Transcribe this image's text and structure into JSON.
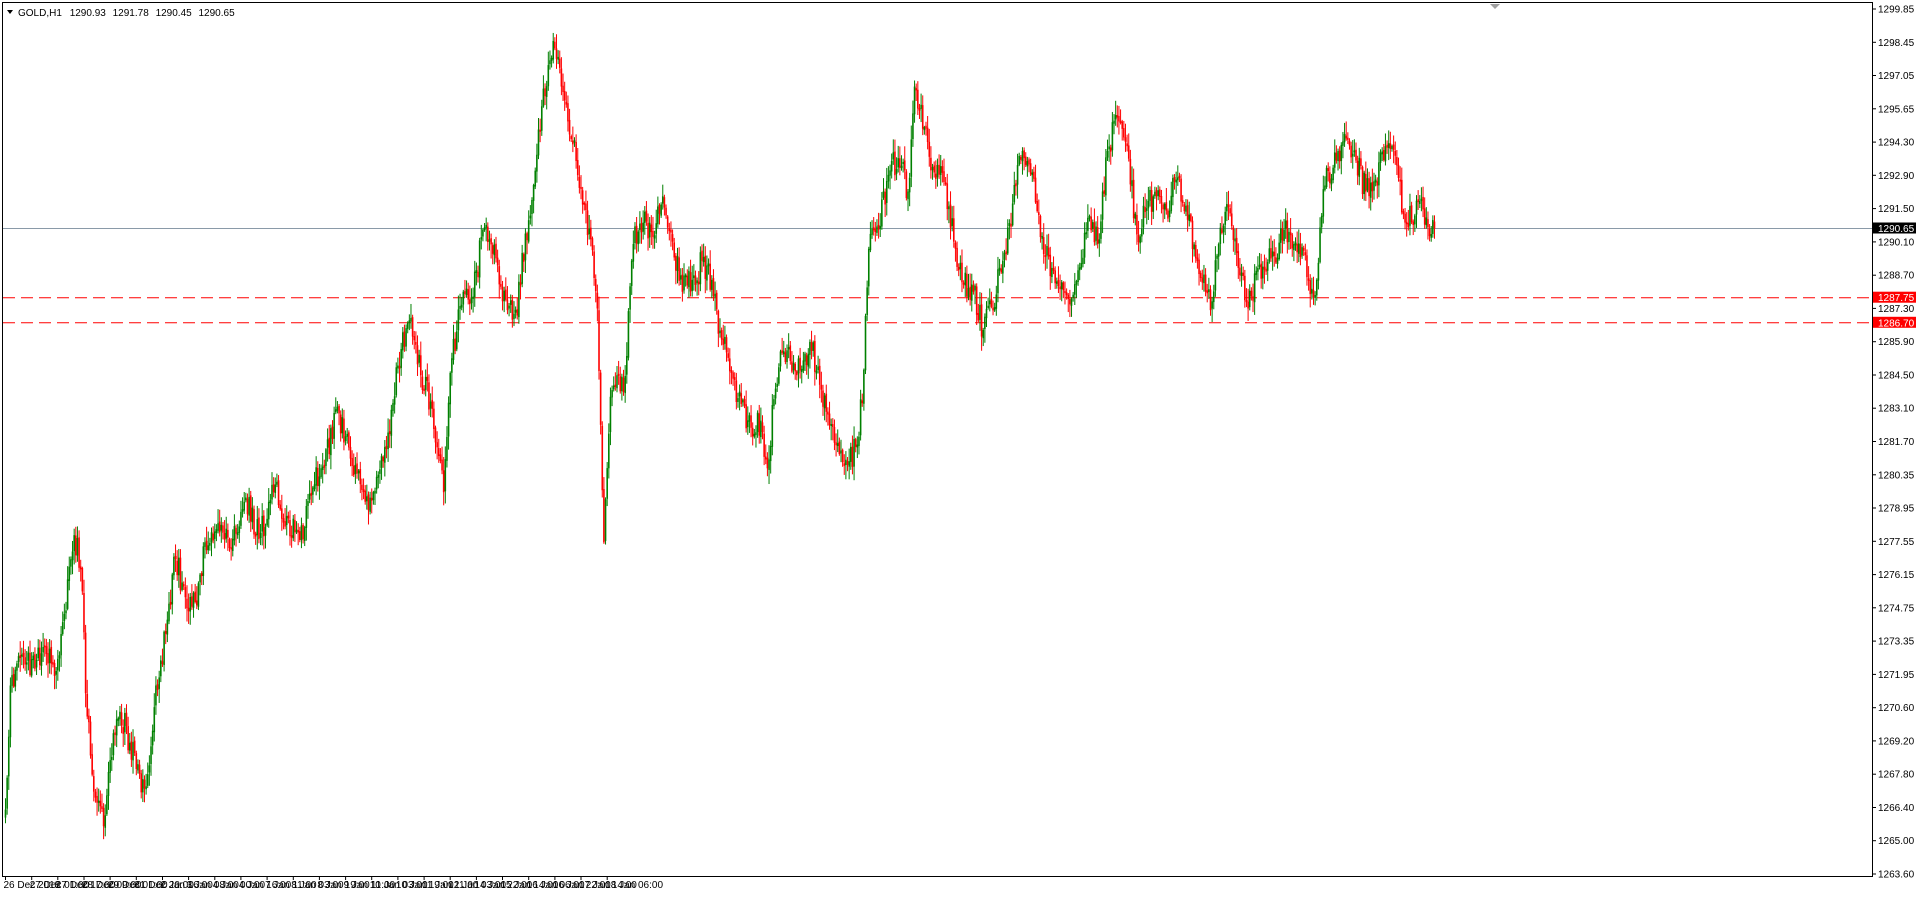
{
  "header": {
    "symbol": "GOLD,H1",
    "open": "1290.93",
    "high": "1291.78",
    "low": "1290.45",
    "close": "1290.65"
  },
  "chart_data": {
    "type": "candlestick",
    "title": "GOLD,H1",
    "ylim": [
      1263.6,
      1299.85
    ],
    "y_ticks": [
      "1299.85",
      "1298.45",
      "1297.05",
      "1295.65",
      "1294.30",
      "1292.90",
      "1291.50",
      "1290.10",
      "1288.70",
      "1287.30",
      "1285.90",
      "1284.50",
      "1283.10",
      "1281.70",
      "1280.35",
      "1278.95",
      "1277.55",
      "1276.15",
      "1274.75",
      "1273.35",
      "1271.95",
      "1270.60",
      "1269.20",
      "1267.80",
      "1266.40",
      "1265.00",
      "1263.60"
    ],
    "x_ticks": [
      "26 Dec 2018",
      "27 Dec 01:00",
      "27 Dec 17:00",
      "28 Dec 09:00",
      "29 Dec 01:00",
      "31 Dec 20:00",
      "2 Jan 16:00",
      "3 Jan 08:00",
      "4 Jan 00:00",
      "4 Jan 16:00",
      "7 Jan 11:00",
      "8 Jan 03:00",
      "8 Jan 19:00",
      "9 Jan 11:00",
      "10 Jan 03:00",
      "10 Jan 19:00",
      "11 Jan 11:00",
      "12 Jan 03:00",
      "14 Jan 22:00",
      "15 Jan 14:00",
      "16 Jan 06:00",
      "16 Jan 22:00",
      "17 Jan 14:00",
      "18 Jan 06:00"
    ],
    "bars_per_tick": 16,
    "current_price": {
      "value": 1290.65,
      "label": "1290.65",
      "color": "#000000"
    },
    "levels": [
      {
        "value": 1287.75,
        "label": "1287.75",
        "color": "#ff0000"
      },
      {
        "value": 1286.7,
        "label": "1286.70",
        "color": "#ff0000"
      }
    ],
    "bull_color": "#008000",
    "bear_color": "#ff0000",
    "close_path": [
      [
        0,
        1266.3
      ],
      [
        3,
        1271.5
      ],
      [
        10,
        1272.8
      ],
      [
        18,
        1272.2
      ],
      [
        24,
        1273.1
      ],
      [
        30,
        1271.9
      ],
      [
        36,
        1274.5
      ],
      [
        42,
        1277.8
      ],
      [
        46,
        1276.5
      ],
      [
        50,
        1270.2
      ],
      [
        55,
        1266.8
      ],
      [
        60,
        1265.6
      ],
      [
        66,
        1269.5
      ],
      [
        70,
        1270.4
      ],
      [
        76,
        1269.1
      ],
      [
        80,
        1268.0
      ],
      [
        86,
        1267.2
      ],
      [
        92,
        1271.5
      ],
      [
        98,
        1273.8
      ],
      [
        104,
        1276.8
      ],
      [
        110,
        1275.2
      ],
      [
        116,
        1275.0
      ],
      [
        122,
        1277.5
      ],
      [
        130,
        1278.3
      ],
      [
        138,
        1277.2
      ],
      [
        146,
        1279.2
      ],
      [
        156,
        1277.9
      ],
      [
        164,
        1279.6
      ],
      [
        172,
        1278.6
      ],
      [
        180,
        1277.6
      ],
      [
        188,
        1279.8
      ],
      [
        196,
        1281.4
      ],
      [
        204,
        1282.9
      ],
      [
        212,
        1280.7
      ],
      [
        220,
        1279.2
      ],
      [
        226,
        1279.6
      ],
      [
        234,
        1282.1
      ],
      [
        242,
        1285.6
      ],
      [
        248,
        1286.9
      ],
      [
        254,
        1284.5
      ],
      [
        260,
        1283.4
      ],
      [
        268,
        1279.6
      ],
      [
        272,
        1284.6
      ],
      [
        280,
        1288.0
      ],
      [
        286,
        1287.8
      ],
      [
        292,
        1290.6
      ],
      [
        300,
        1289.4
      ],
      [
        304,
        1287.6
      ],
      [
        312,
        1287.1
      ],
      [
        320,
        1291.0
      ],
      [
        326,
        1294.8
      ],
      [
        332,
        1297.5
      ],
      [
        336,
        1298.2
      ],
      [
        340,
        1296.6
      ],
      [
        346,
        1294.5
      ],
      [
        352,
        1292.3
      ],
      [
        358,
        1290.2
      ],
      [
        362,
        1287.3
      ],
      [
        366,
        1277.5
      ],
      [
        370,
        1283.6
      ],
      [
        374,
        1284.5
      ],
      [
        378,
        1283.8
      ],
      [
        384,
        1290.0
      ],
      [
        390,
        1290.9
      ],
      [
        396,
        1290.3
      ],
      [
        402,
        1292.0
      ],
      [
        408,
        1290.1
      ],
      [
        414,
        1288.0
      ],
      [
        420,
        1288.5
      ],
      [
        426,
        1289.3
      ],
      [
        432,
        1288.5
      ],
      [
        438,
        1286.0
      ],
      [
        444,
        1284.6
      ],
      [
        450,
        1283.3
      ],
      [
        456,
        1282.3
      ],
      [
        462,
        1282.6
      ],
      [
        466,
        1280.6
      ],
      [
        470,
        1283.5
      ],
      [
        474,
        1285.5
      ],
      [
        480,
        1285.1
      ],
      [
        486,
        1284.7
      ],
      [
        492,
        1285.9
      ],
      [
        498,
        1284.1
      ],
      [
        504,
        1282.4
      ],
      [
        510,
        1281.2
      ],
      [
        516,
        1280.9
      ],
      [
        520,
        1281.5
      ],
      [
        524,
        1283.4
      ],
      [
        528,
        1289.8
      ],
      [
        534,
        1290.6
      ],
      [
        540,
        1292.9
      ],
      [
        546,
        1293.6
      ],
      [
        552,
        1292.2
      ],
      [
        556,
        1296.6
      ],
      [
        562,
        1294.9
      ],
      [
        568,
        1293.0
      ],
      [
        574,
        1292.6
      ],
      [
        580,
        1290.1
      ],
      [
        586,
        1288.3
      ],
      [
        592,
        1288.0
      ],
      [
        598,
        1286.4
      ],
      [
        604,
        1287.4
      ],
      [
        610,
        1289.3
      ],
      [
        616,
        1291.7
      ],
      [
        622,
        1293.9
      ],
      [
        628,
        1293.0
      ],
      [
        634,
        1290.2
      ],
      [
        640,
        1289.0
      ],
      [
        646,
        1288.4
      ],
      [
        650,
        1287.7
      ],
      [
        656,
        1288.9
      ],
      [
        662,
        1291.1
      ],
      [
        668,
        1290.0
      ],
      [
        674,
        1293.9
      ],
      [
        680,
        1295.3
      ],
      [
        686,
        1294.1
      ],
      [
        692,
        1290.4
      ],
      [
        698,
        1291.5
      ],
      [
        704,
        1292.0
      ],
      [
        710,
        1291.4
      ],
      [
        716,
        1292.7
      ],
      [
        722,
        1291.6
      ],
      [
        728,
        1289.4
      ],
      [
        734,
        1288.0
      ],
      [
        738,
        1287.6
      ],
      [
        742,
        1290.0
      ],
      [
        748,
        1291.7
      ],
      [
        754,
        1289.0
      ],
      [
        760,
        1287.3
      ],
      [
        766,
        1289.0
      ],
      [
        770,
        1289.1
      ],
      [
        776,
        1289.5
      ],
      [
        782,
        1290.6
      ],
      [
        788,
        1290.0
      ],
      [
        794,
        1289.8
      ],
      [
        798,
        1287.9
      ],
      [
        802,
        1288.5
      ],
      [
        806,
        1292.3
      ],
      [
        812,
        1293.2
      ],
      [
        818,
        1294.3
      ],
      [
        826,
        1293.5
      ],
      [
        832,
        1292.2
      ],
      [
        838,
        1292.7
      ],
      [
        844,
        1294.1
      ],
      [
        850,
        1293.7
      ],
      [
        856,
        1290.9
      ],
      [
        862,
        1291.2
      ],
      [
        866,
        1291.9
      ],
      [
        870,
        1290.7
      ],
      [
        874,
        1290.65
      ]
    ]
  }
}
